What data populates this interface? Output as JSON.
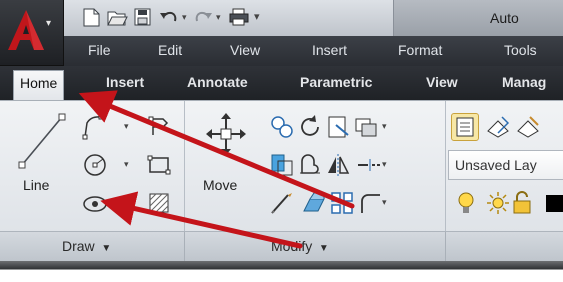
{
  "window": {
    "title": "Auto"
  },
  "menu": [
    "File",
    "Edit",
    "View",
    "Insert",
    "Format",
    "Tools"
  ],
  "ribbon_tabs": [
    "Home",
    "Insert",
    "Annotate",
    "Parametric",
    "View",
    "Manag"
  ],
  "active_tab": "Home",
  "draw_panel": {
    "line_label": "Line",
    "footer_label": "Draw"
  },
  "modify_panel": {
    "move_label": "Move",
    "footer_label": "Modify"
  },
  "layers_panel": {
    "layer_field_value": "Unsaved Lay"
  },
  "colors": {
    "accent_red": "#c0161b",
    "annotation_arrow": "#c4141a"
  },
  "icons": {
    "app_menu": "autocad-logo-icon",
    "qat": [
      "new-icon",
      "open-icon",
      "save-icon",
      "undo-icon",
      "redo-icon",
      "plot-icon",
      "qat-dropdown-icon"
    ]
  }
}
